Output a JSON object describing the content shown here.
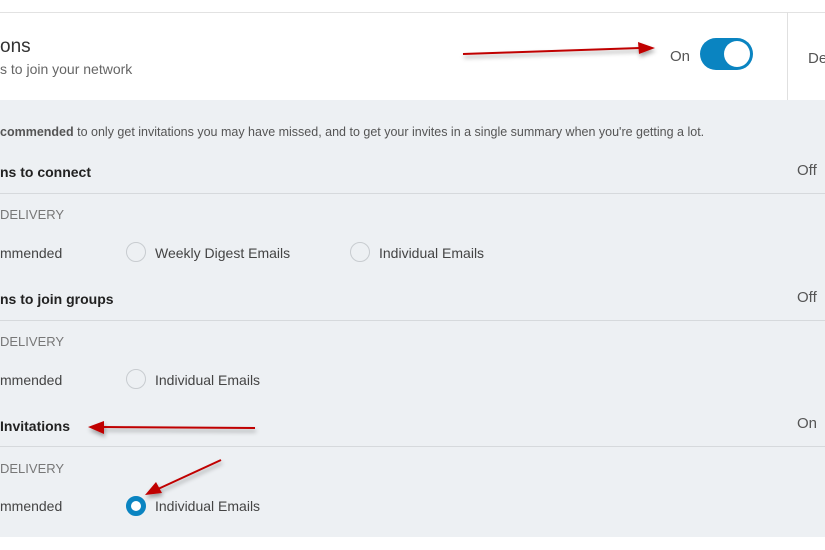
{
  "header": {
    "title": "ons",
    "subtitle": "s to join your network",
    "toggle_label": "On",
    "toggle_on": true,
    "side_text": "De"
  },
  "info": {
    "bold": "commended",
    "text": " to only get invitations you may have missed, and to get your invites in a single summary when you're getting a lot."
  },
  "sections": [
    {
      "title": "ns to connect",
      "state": "Off",
      "delivery_label": "DELIVERY",
      "options": [
        {
          "label": "mmended"
        },
        {
          "label": "Weekly Digest Emails",
          "selected": false
        },
        {
          "label": "Individual Emails",
          "selected": false
        }
      ]
    },
    {
      "title": "ns to join groups",
      "state": "Off",
      "delivery_label": "DELIVERY",
      "options": [
        {
          "label": "mmended"
        },
        {
          "label": "Individual Emails",
          "selected": false
        }
      ]
    },
    {
      "title": " Invitations",
      "state": "On",
      "delivery_label": "DELIVERY",
      "options": [
        {
          "label": "mmended"
        },
        {
          "label": "Individual Emails",
          "selected": true
        }
      ]
    }
  ],
  "colors": {
    "accent": "#0a84c1",
    "annotation_arrow": "#c00000",
    "background": "#edf0f3"
  }
}
